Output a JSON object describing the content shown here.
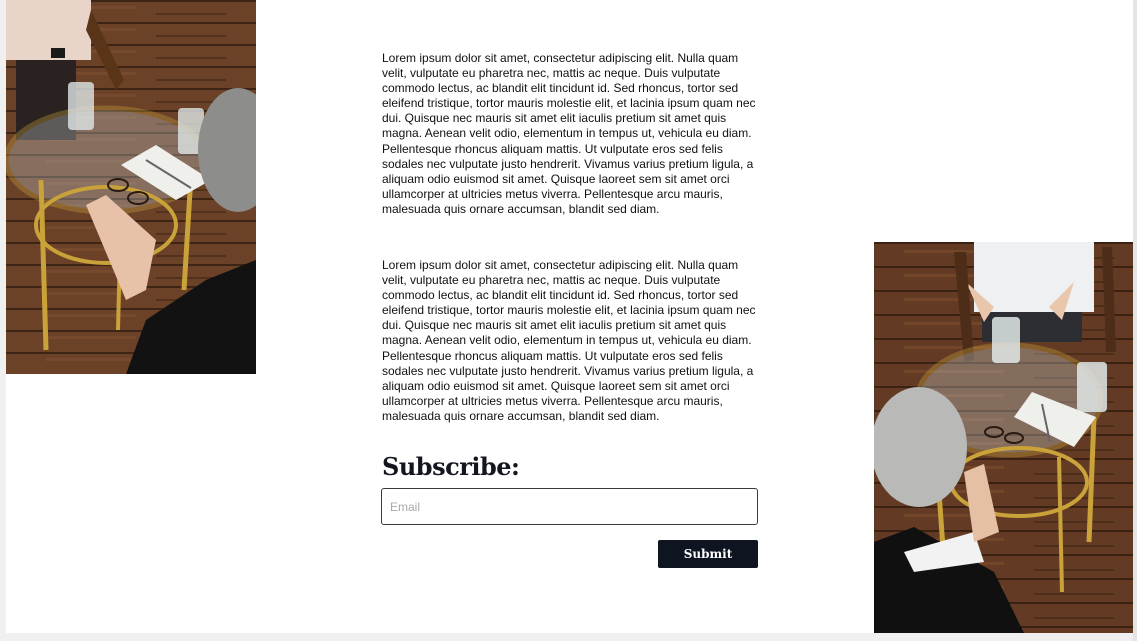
{
  "content": {
    "paragraphs": [
      "Lorem ipsum dolor sit amet, consectetur adipiscing elit. Nulla quam velit, vulputate eu pharetra nec, mattis ac neque. Duis vulputate commodo lectus, ac blandit elit tincidunt id. Sed rhoncus, tortor sed eleifend tristique, tortor mauris molestie elit, et lacinia ipsum quam nec dui. Quisque nec mauris sit amet elit iaculis pretium sit amet quis magna. Aenean velit odio, elementum in tempus ut, vehicula eu diam. Pellentesque rhoncus aliquam mattis. Ut vulputate eros sed felis sodales nec vulputate justo hendrerit. Vivamus varius pretium ligula, a aliquam odio euismod sit amet. Quisque laoreet sem sit amet orci ullamcorper at ultricies metus viverra. Pellentesque arcu mauris, malesuada quis ornare accumsan, blandit sed diam.",
      "Lorem ipsum dolor sit amet, consectetur adipiscing elit. Nulla quam velit, vulputate eu pharetra nec, mattis ac neque. Duis vulputate commodo lectus, ac blandit elit tincidunt id. Sed rhoncus, tortor sed eleifend tristique, tortor mauris molestie elit, et lacinia ipsum quam nec dui. Quisque nec mauris sit amet elit iaculis pretium sit amet quis magna. Aenean velit odio, elementum in tempus ut, vehicula eu diam. Pellentesque rhoncus aliquam mattis. Ut vulputate eros sed felis sodales nec vulputate justo hendrerit. Vivamus varius pretium ligula, a aliquam odio euismod sit amet. Quisque laoreet sem sit amet orci ullamcorper at ultricies metus viverra. Pellentesque arcu mauris, malesuada quis ornare accumsan, blandit sed diam."
    ]
  },
  "subscribe": {
    "title": "Subscribe:",
    "email_placeholder": "Email",
    "email_value": "",
    "submit_label": "Submit"
  },
  "colors": {
    "button_bg": "#0f1520",
    "title_color": "#14161f",
    "floor": "#5a3520",
    "brass": "#c9a23a"
  },
  "images": [
    {
      "name": "therapy-session-photo-left"
    },
    {
      "name": "therapy-session-photo-right"
    }
  ]
}
